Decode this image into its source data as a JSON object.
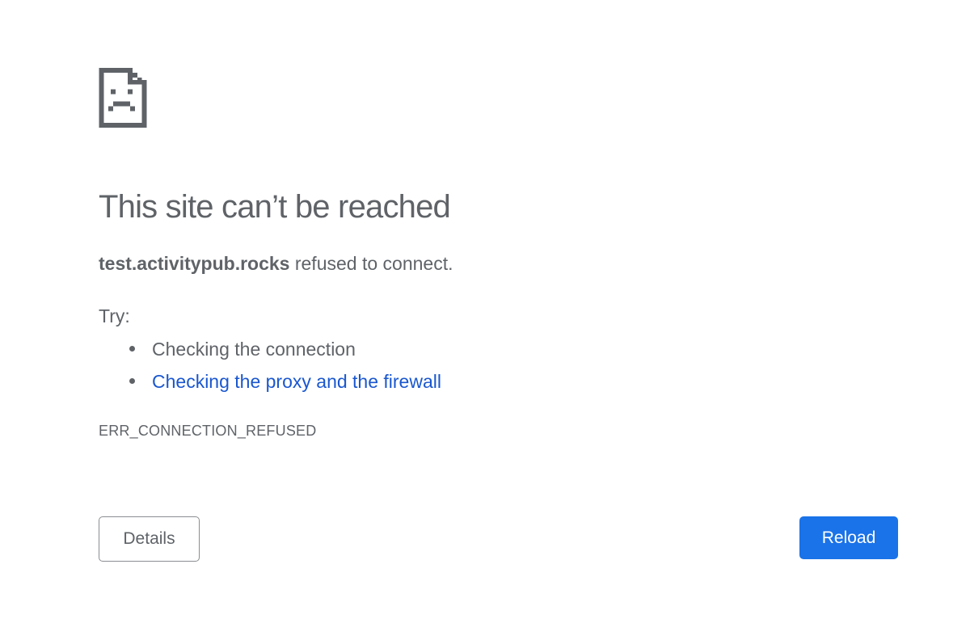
{
  "page": {
    "icon": "sad-page-icon",
    "title": "This site can’t be reached",
    "host": "test.activitypub.rocks",
    "message_suffix": " refused to connect.",
    "try_label": "Try:",
    "suggestions": [
      {
        "text": "Checking the connection",
        "is_link": false
      },
      {
        "text": "Checking the proxy and the firewall",
        "is_link": true
      }
    ],
    "error_code": "ERR_CONNECTION_REFUSED"
  },
  "buttons": {
    "details_label": "Details",
    "reload_label": "Reload"
  },
  "colors": {
    "text": "#5f6368",
    "link": "#1a57cf",
    "primary_button": "#1a73e8",
    "background": "#ffffff"
  }
}
